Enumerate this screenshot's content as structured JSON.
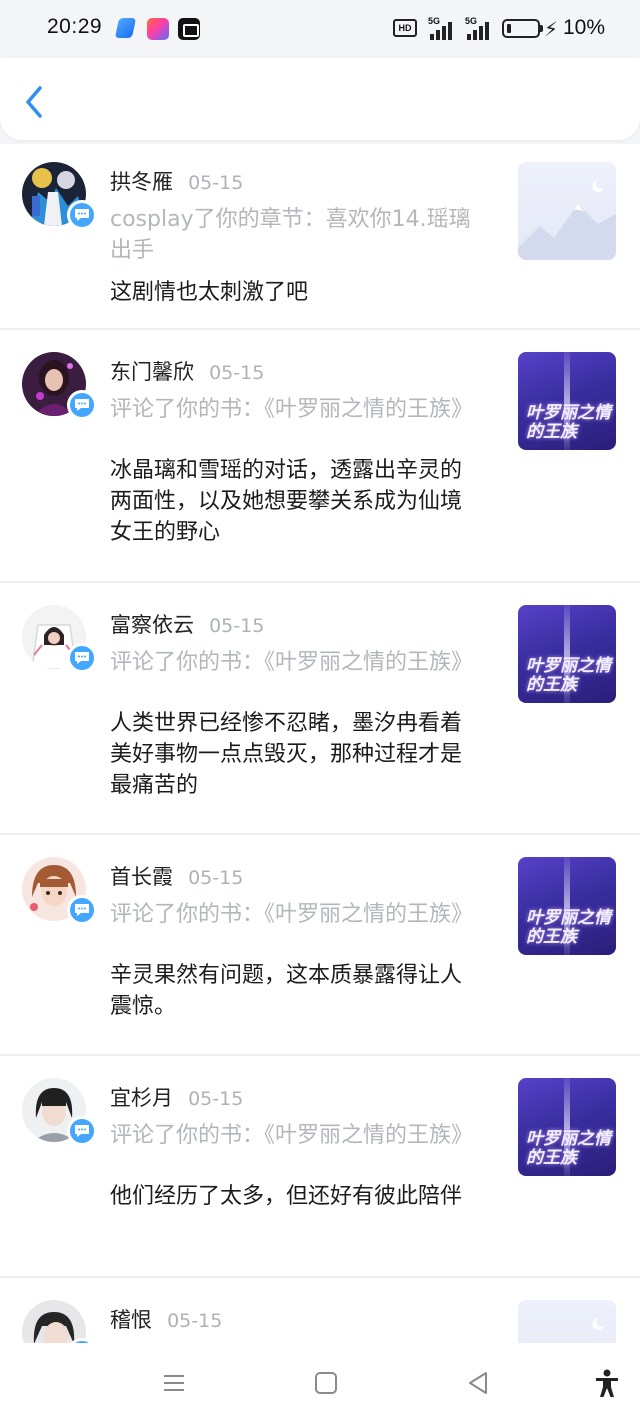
{
  "status_bar": {
    "time": "20:29",
    "hd_label": "HD",
    "signal1_label": "5G",
    "signal2_label": "5G",
    "battery_percent": "10%",
    "apps": [
      "blue-app-icon",
      "colorful-app-icon",
      "capcut-icon"
    ]
  },
  "header": {
    "back_icon": "chevron-left-icon",
    "accent_color": "#2f8ff0"
  },
  "notifications": [
    {
      "user": "拱冬雁",
      "date": "05-15",
      "action": "cosplay了你的章节：喜欢你14.瑶璃出手",
      "content": "这剧情也太刺激了吧",
      "thumbnail": "placeholder-mountain"
    },
    {
      "user": "东门馨欣",
      "date": "05-15",
      "action": "评论了你的书：《叶罗丽之情的王族》",
      "content": "冰晶璃和雪瑶的对话，透露出辛灵的两面性，以及她想要攀关系成为仙境女王的野心",
      "thumbnail": "book-cover",
      "cover_title": "叶罗丽之情的王族"
    },
    {
      "user": "富察依云",
      "date": "05-15",
      "action": "评论了你的书：《叶罗丽之情的王族》",
      "content": "人类世界已经惨不忍睹，墨汐冉看着美好事物一点点毁灭，那种过程才是最痛苦的",
      "thumbnail": "book-cover",
      "cover_title": "叶罗丽之情的王族"
    },
    {
      "user": "首长霞",
      "date": "05-15",
      "action": "评论了你的书：《叶罗丽之情的王族》",
      "content": "辛灵果然有问题，这本质暴露得让人震惊。",
      "thumbnail": "book-cover",
      "cover_title": "叶罗丽之情的王族"
    },
    {
      "user": "宜杉月",
      "date": "05-15",
      "action": "评论了你的书：《叶罗丽之情的王族》",
      "content": "他们经历了太多，但还好有彼此陪伴",
      "thumbnail": "book-cover",
      "cover_title": "叶罗丽之情的王族"
    },
    {
      "user": "稽恨",
      "date": "05-15",
      "thumbnail": "placeholder-mountain"
    }
  ],
  "nav_bar": {
    "icons": [
      "menu-icon",
      "home-square-icon",
      "back-triangle-icon",
      "accessibility-icon"
    ]
  },
  "colors": {
    "badge": "#43a6ff",
    "muted_text": "#b3b6bb",
    "date_text": "#aeb2b8",
    "cover_purple": "#4a37b8"
  }
}
